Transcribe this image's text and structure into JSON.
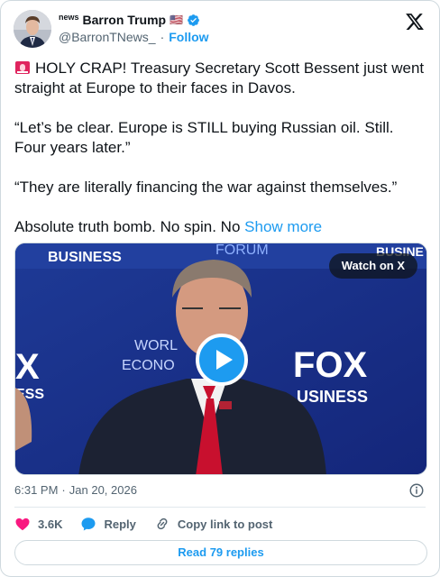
{
  "author": {
    "name_prefix": "news",
    "name": "Barron Trump",
    "flag": "🇺🇸",
    "handle": "@BarronTNews_",
    "separator": "·",
    "follow_label": "Follow",
    "verified_icon": "verified-badge-icon"
  },
  "tweet": {
    "lines": [
      "HOLY CRAP! Treasury Secretary Scott Bessent just went straight at Europe to their faces in Davos.",
      "“Let’s be clear. Europe is STILL buying Russian oil. Still. Four years later.”",
      "“They are literally financing the war against themselves.”",
      "Absolute truth bomb. No spin. No"
    ],
    "show_more": "Show more",
    "siren_icon": "siren-icon"
  },
  "media": {
    "watch_label": "Watch on X",
    "bg_texts": {
      "business_left": "BUSINESS",
      "forum": "FORUM",
      "business_right": "BUSINE",
      "world": "WORL",
      "economic": "ECONO",
      "fox": "FOX",
      "fox_business": "USINESS",
      "fox_left": "X",
      "fox_left_sub": "ESS"
    }
  },
  "meta": {
    "time": "6:31 PM",
    "separator": "·",
    "date": "Jan 20, 2026"
  },
  "actions": {
    "likes": "3.6K",
    "reply_label": "Reply",
    "copy_label": "Copy link to post"
  },
  "footer": {
    "read_replies": "Read 79 replies"
  },
  "colors": {
    "accent": "#1d9bf0",
    "like": "#f91880",
    "text": "#0f1419",
    "secondary": "#536471"
  }
}
